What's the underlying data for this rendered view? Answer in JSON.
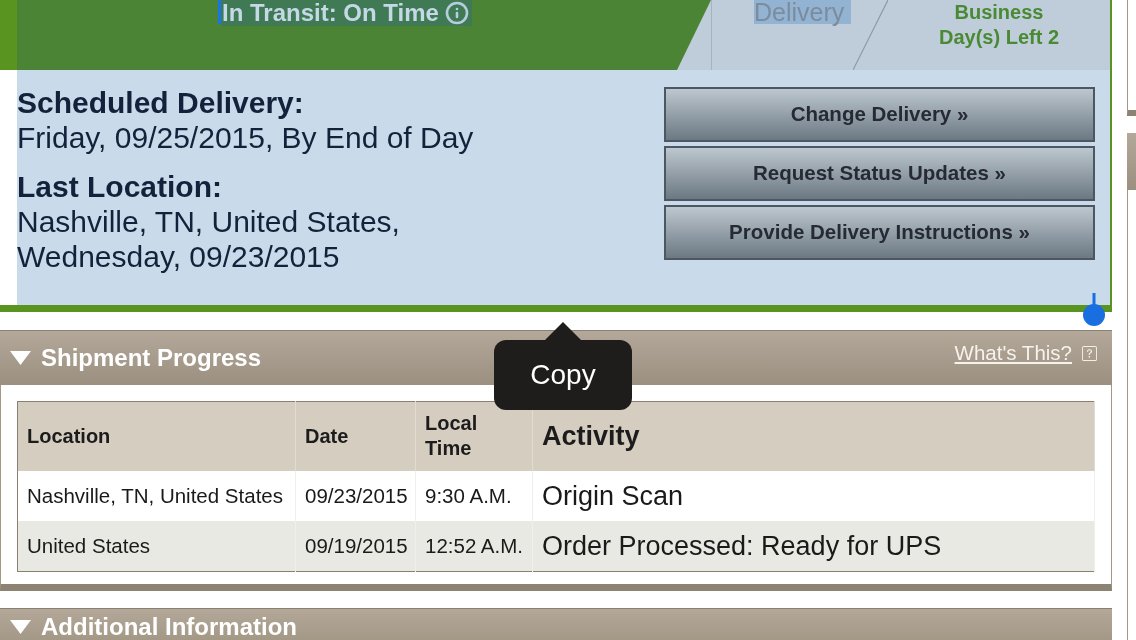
{
  "tracking_banner": {
    "highlighted": true,
    "status": {
      "text": "In Transit: On Time",
      "highlighted": true
    },
    "steps": [
      {
        "label": "Delivery",
        "highlighted": true
      }
    ],
    "days_left": "Business Day(s) Left 2"
  },
  "delivery_details": {
    "highlighted": true,
    "fields": [
      {
        "label": "Scheduled Delivery:",
        "lines": [
          "Friday, 09/25/2015, By End of Day"
        ]
      },
      {
        "label": "Last Location:",
        "lines": [
          "Nashville, TN, United States,",
          "Wednesday, 09/23/2015"
        ]
      }
    ],
    "actions": [
      "Change Delivery »",
      "Request Status Updates »",
      "Provide Delivery Instructions »"
    ]
  },
  "shipment_progress": {
    "title": "Shipment Progress",
    "expanded": true,
    "help_link": "What's This?",
    "table": {
      "columns": [
        "Location",
        "Date",
        "Local Time",
        "Activity"
      ],
      "rows": [
        [
          "Nashville, TN, United States",
          "09/23/2015",
          "9:30 A.M.",
          "Origin Scan"
        ],
        [
          "United States",
          "09/19/2015",
          "12:52 A.M.",
          "Order Processed: Ready for UPS"
        ]
      ]
    }
  },
  "additional_information": {
    "title": "Additional Information",
    "expanded": true
  },
  "copy_menu": {
    "items": [
      "Copy"
    ]
  }
}
